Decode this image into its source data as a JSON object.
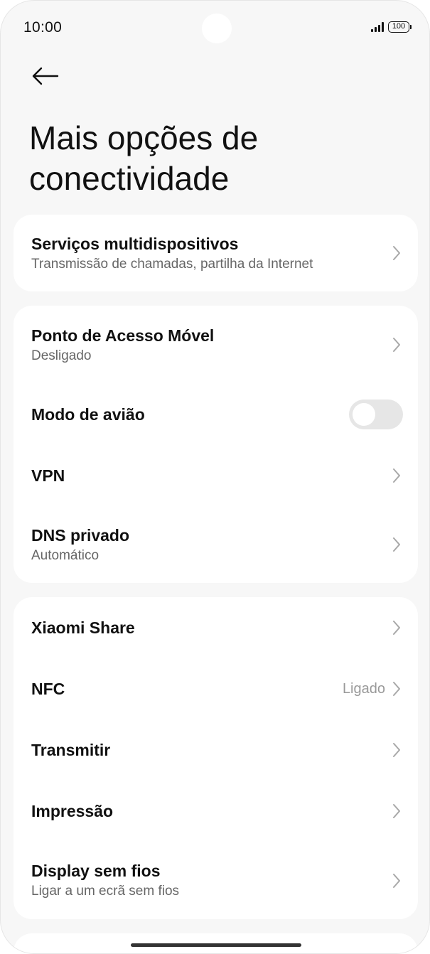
{
  "status_bar": {
    "time": "10:00",
    "battery": "100"
  },
  "header": {
    "title": "Mais opções de conectividade",
    "back_icon": "arrow-left-icon"
  },
  "cards": [
    {
      "items": [
        {
          "title": "Serviços multidispositivos",
          "subtitle": "Transmissão de chamadas, partilha da Internet",
          "type": "chevron"
        }
      ]
    },
    {
      "items": [
        {
          "title": "Ponto de Acesso Móvel",
          "subtitle": "Desligado",
          "type": "chevron"
        },
        {
          "title": "Modo de avião",
          "type": "toggle",
          "enabled": false
        },
        {
          "title": "VPN",
          "type": "chevron"
        },
        {
          "title": "DNS privado",
          "subtitle": "Automático",
          "type": "chevron"
        }
      ]
    },
    {
      "items": [
        {
          "title": "Xiaomi Share",
          "type": "chevron"
        },
        {
          "title": "NFC",
          "value": "Ligado",
          "type": "chevron"
        },
        {
          "title": "Transmitir",
          "type": "chevron"
        },
        {
          "title": "Impressão",
          "type": "chevron"
        },
        {
          "title": "Display sem fios",
          "subtitle": "Ligar a um ecrã sem fios",
          "type": "chevron"
        }
      ]
    }
  ],
  "colors": {
    "background": "#f7f7f7",
    "card": "#ffffff",
    "title_text": "#111111",
    "subtitle_text": "#666666",
    "chevron": "#a8a8a8",
    "toggle_off": "#e6e6e6"
  }
}
